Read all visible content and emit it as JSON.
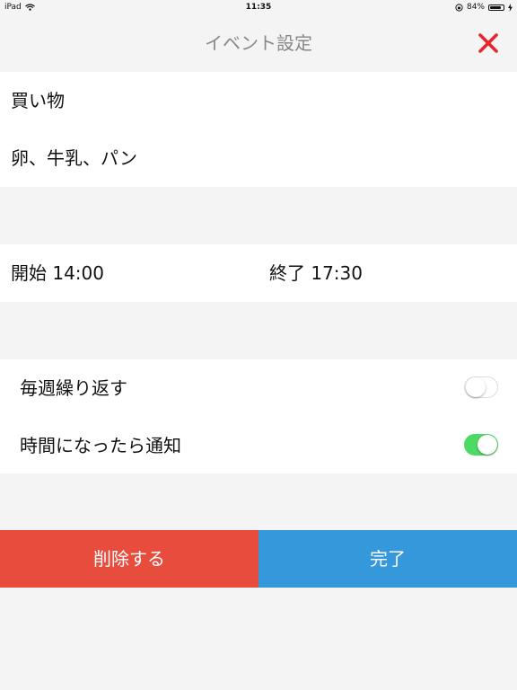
{
  "status_bar": {
    "device": "iPad",
    "time": "11:35",
    "battery": "84%",
    "battery_level": 0.84
  },
  "header": {
    "title": "イベント設定",
    "close_icon": "close-x-icon",
    "close_color": "#e8262b"
  },
  "event": {
    "title_value": "買い物",
    "memo_value": "卵、牛乳、パン"
  },
  "time": {
    "start": "開始 14:00",
    "end": "終了 17:30"
  },
  "options": {
    "repeat_weekly": {
      "label": "毎週繰り返す",
      "on": false
    },
    "notify": {
      "label": "時間になったら通知",
      "on": true
    }
  },
  "actions": {
    "delete_label": "削除する",
    "delete_color": "#e84c3d",
    "done_label": "完了",
    "done_color": "#3498db"
  }
}
